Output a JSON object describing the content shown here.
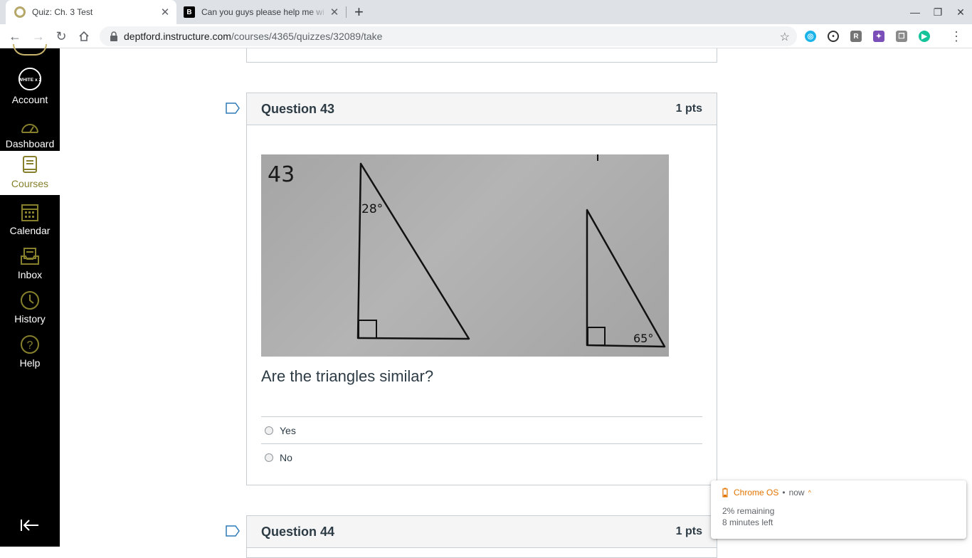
{
  "browser": {
    "tabs": [
      {
        "title": "Quiz: Ch. 3 Test",
        "active": true
      },
      {
        "title": "Can you guys please help me wi",
        "active": false
      }
    ],
    "url_host": "deptford.instructure.com",
    "url_path": "/courses/4365/quizzes/32089/take",
    "extensions": [
      "R"
    ]
  },
  "nav": {
    "items": [
      {
        "label": "Account",
        "icon": "avatar-icon"
      },
      {
        "label": "Dashboard",
        "icon": "dashboard-icon"
      },
      {
        "label": "Courses",
        "icon": "courses-icon",
        "active": true
      },
      {
        "label": "Calendar",
        "icon": "calendar-icon"
      },
      {
        "label": "Inbox",
        "icon": "inbox-icon"
      },
      {
        "label": "History",
        "icon": "history-icon"
      },
      {
        "label": "Help",
        "icon": "help-icon"
      }
    ],
    "avatar_text": "WHITE x 2"
  },
  "questions": [
    {
      "name": "Question 43",
      "points": "1 pts",
      "image_labels": {
        "number": "43",
        "angle_left": "28°",
        "angle_right": "65°"
      },
      "text": "Are the triangles similar?",
      "answers": [
        "Yes",
        "No"
      ]
    },
    {
      "name": "Question 44",
      "points": "1 pts"
    }
  ],
  "notification": {
    "app": "Chrome OS",
    "time": "now",
    "line1": "2% remaining",
    "line2": "8 minutes left"
  },
  "colors": {
    "nav_bg": "#000000",
    "nav_active": "#867f2b",
    "text": "#2d3b45",
    "notif_accent": "#e37400"
  }
}
